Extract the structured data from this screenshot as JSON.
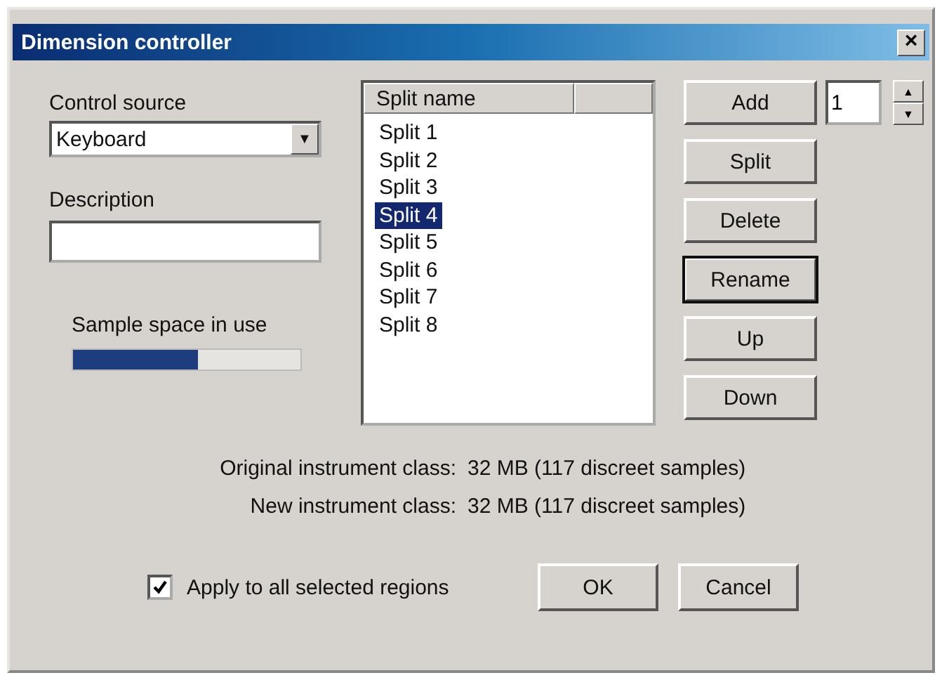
{
  "window": {
    "title": "Dimension controller",
    "close": "×"
  },
  "control_source": {
    "label": "Control source",
    "value": "Keyboard",
    "arrow": "▼"
  },
  "description": {
    "label": "Description"
  },
  "sample_space": {
    "label": "Sample space in use",
    "level": 0.55
  },
  "split_list": {
    "columns": [
      "Split name"
    ],
    "items": [
      {
        "label": "Split 1",
        "selected": false
      },
      {
        "label": "Split 2",
        "selected": false
      },
      {
        "label": "Split 3",
        "selected": false
      },
      {
        "label": "Split 4",
        "selected": true
      },
      {
        "label": "Split 5",
        "selected": false
      },
      {
        "label": "Split 6",
        "selected": false
      },
      {
        "label": "Split 7",
        "selected": false
      },
      {
        "label": "Split 8",
        "selected": false
      }
    ]
  },
  "buttons": [
    {
      "label": "Add",
      "focused": false
    },
    {
      "label": "Split",
      "focused": false
    },
    {
      "label": "Delete",
      "focused": false
    },
    {
      "label": "Rename",
      "focused": true
    },
    {
      "label": "Up",
      "focused": false
    },
    {
      "label": "Down",
      "focused": false
    }
  ],
  "count": {
    "value": "1",
    "up": "▲",
    "down": "▼"
  },
  "info": [
    {
      "label": "Original instrument class:",
      "value": "32 MB (117 discreet samples)"
    },
    {
      "label": "New instrument class:",
      "value": "32 MB (117 discreet samples)"
    }
  ],
  "apply_all": {
    "label": "Apply to all selected regions",
    "checked": true
  },
  "footer_buttons": [
    "OK",
    "Cancel"
  ]
}
